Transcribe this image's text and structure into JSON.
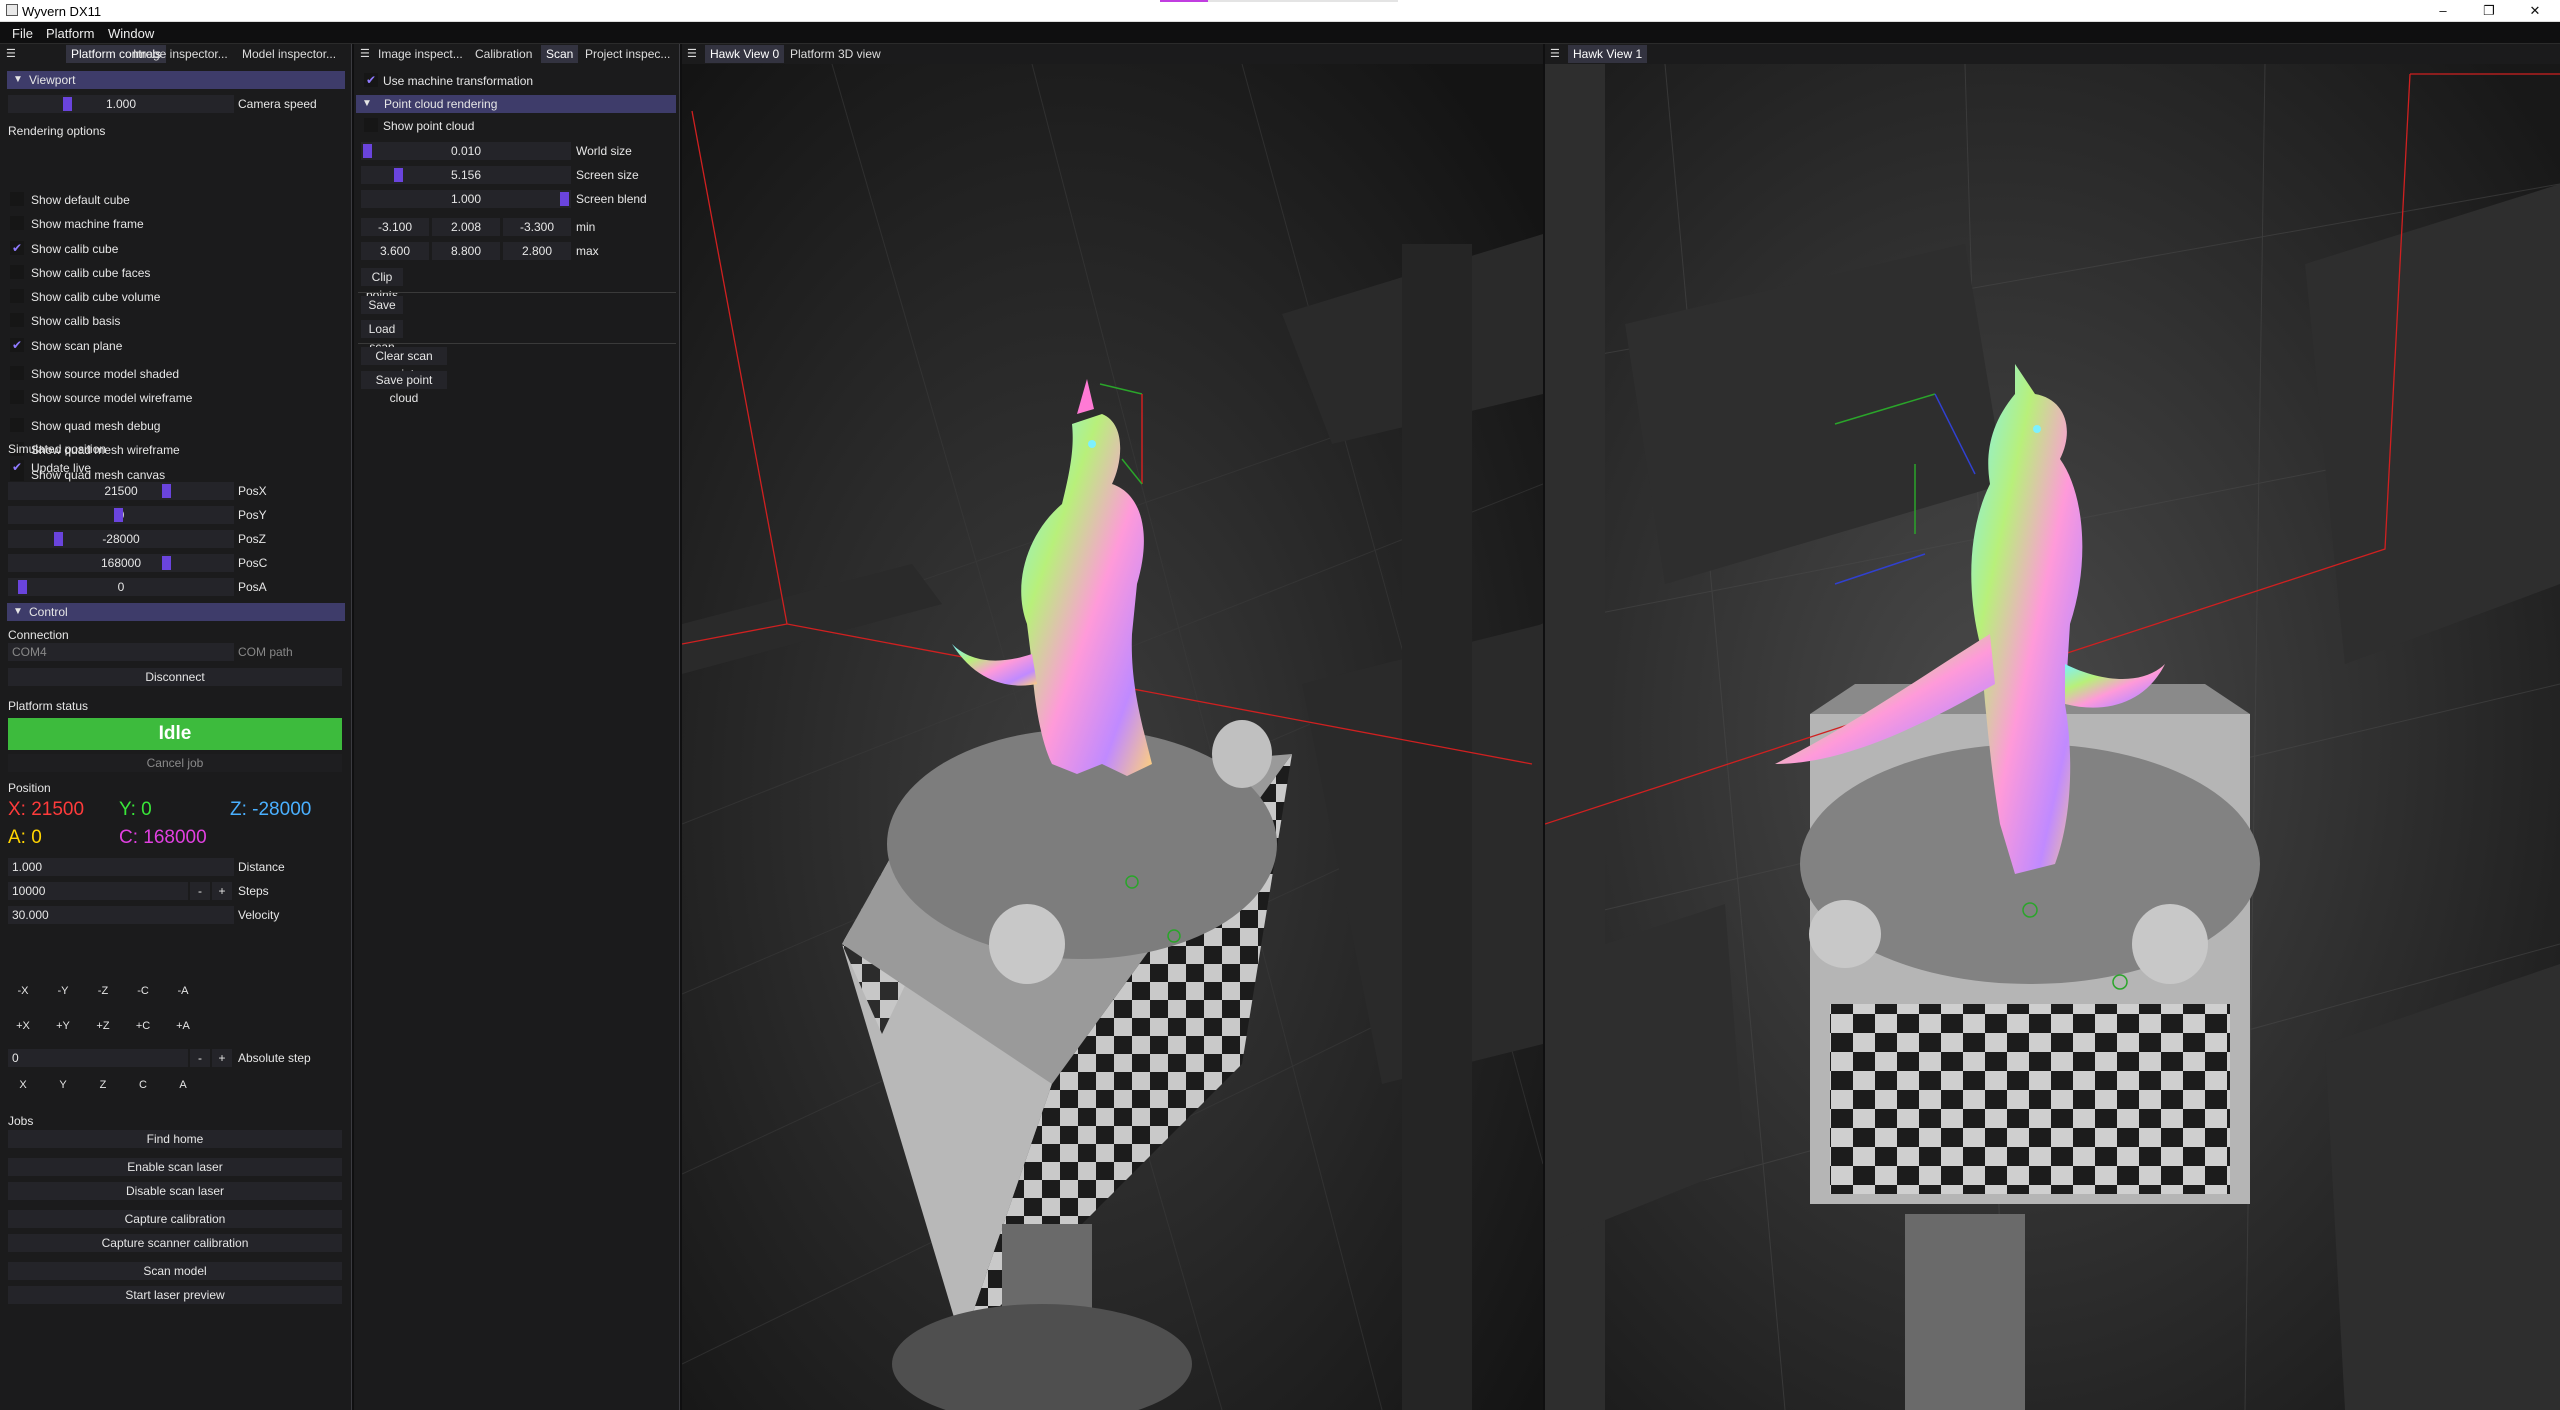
{
  "window": {
    "title": "Wyvern DX11",
    "accent_color": "#c13ee0"
  },
  "menu": [
    "File",
    "Platform",
    "Window"
  ],
  "left_panel": {
    "tabs": [
      "Platform controls",
      "Image inspector...",
      "Model inspector..."
    ],
    "viewport": {
      "header": "Viewport",
      "camera_speed_value": "1.000",
      "camera_speed_label": "Camera speed"
    },
    "rendering_options": {
      "title": "Rendering options",
      "items": [
        {
          "label": "Show default cube",
          "checked": false
        },
        {
          "label": "Show machine frame",
          "checked": false
        },
        {
          "label": "Show calib cube",
          "checked": true
        },
        {
          "label": "Show calib cube faces",
          "checked": false
        },
        {
          "label": "Show calib cube volume",
          "checked": false
        },
        {
          "label": "Show calib basis",
          "checked": false
        },
        {
          "label": "Show scan plane",
          "checked": true
        },
        {
          "label": "Show source model shaded",
          "checked": false
        },
        {
          "label": "Show source model wireframe",
          "checked": false
        },
        {
          "label": "Show quad mesh debug",
          "checked": false
        },
        {
          "label": "Show quad mesh wireframe",
          "checked": false
        },
        {
          "label": "Show quad mesh canvas",
          "checked": false
        }
      ]
    },
    "simulated_position": {
      "title": "Simulated position",
      "update_live": "Update live",
      "rows": [
        {
          "value": "21500",
          "label": "PosX"
        },
        {
          "value": "0",
          "label": "PosY"
        },
        {
          "value": "-28000",
          "label": "PosZ"
        },
        {
          "value": "168000",
          "label": "PosC"
        },
        {
          "value": "0",
          "label": "PosA"
        }
      ]
    },
    "control": {
      "header": "Control",
      "connection_title": "Connection",
      "com_placeholder": "COM4",
      "com_label": "COM path",
      "disconnect": "Disconnect",
      "platform_status_title": "Platform status",
      "status": "Idle",
      "status_color": "#3dbb3d",
      "cancel_job": "Cancel job",
      "position_title": "Position",
      "pos": {
        "x": "X: 21500",
        "y": "Y: 0",
        "z": "Z: -28000",
        "a": "A: 0",
        "c": "C: 168000"
      },
      "pos_colors": {
        "x": "#ff3b3b",
        "y": "#39e639",
        "z": "#4ab0ff",
        "a": "#ffd400",
        "c": "#e040e0"
      },
      "distance_value": "1.000",
      "distance_label": "Distance",
      "steps_value": "10000",
      "steps_label": "Steps",
      "velocity_value": "30.000",
      "velocity_label": "Velocity",
      "minus": "-",
      "plus": "+",
      "neg_buttons": [
        "-X",
        "-Y",
        "-Z",
        "-C",
        "-A"
      ],
      "pos_buttons": [
        "+X",
        "+Y",
        "+Z",
        "+C",
        "+A"
      ],
      "abs_value": "0",
      "abs_label": "Absolute step",
      "axis_buttons": [
        "X",
        "Y",
        "Z",
        "C",
        "A"
      ],
      "jobs_title": "Jobs",
      "jobs": [
        "Find home",
        "Enable scan laser",
        "Disable scan laser",
        "Capture calibration",
        "Capture scanner calibration",
        "Scan model",
        "Start laser preview"
      ]
    }
  },
  "mid_panel": {
    "tabs": [
      "Image inspect...",
      "Calibration",
      "Scan",
      "Project inspec..."
    ],
    "use_machine_transformation": "Use machine transformation",
    "point_cloud_header": "Point cloud rendering",
    "show_point_cloud": "Show point cloud",
    "world_size_value": "0.010",
    "world_size_label": "World size",
    "screen_size_value": "5.156",
    "screen_size_label": "Screen size",
    "screen_blend_value": "1.000",
    "screen_blend_label": "Screen blend",
    "min_values": [
      "-3.100",
      "2.008",
      "-3.300"
    ],
    "min_label": "min",
    "max_values": [
      "3.600",
      "8.800",
      "2.800"
    ],
    "max_label": "max",
    "clip_points": "Clip points",
    "save_scan": "Save scan",
    "load_scan": "Load scan",
    "clear_scan_points": "Clear scan points",
    "save_point_cloud": "Save point cloud"
  },
  "view1": {
    "tabs": [
      "Hawk View 0",
      "Platform 3D view"
    ]
  },
  "view2": {
    "tabs": [
      "Hawk View 1"
    ]
  }
}
